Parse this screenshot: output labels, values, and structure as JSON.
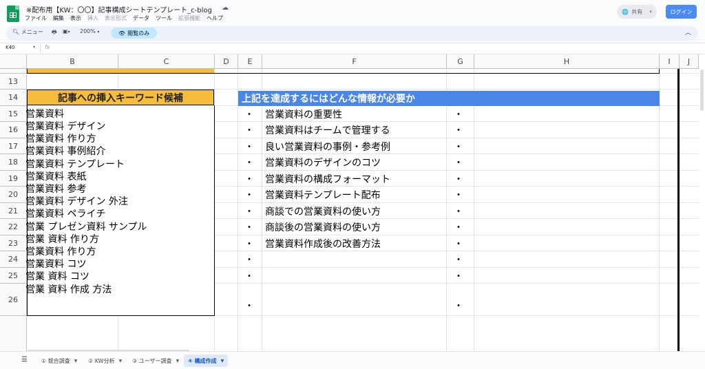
{
  "doc": {
    "title": "※配布用【KW：〇〇】記事構成シートテンプレート_c-blog",
    "menu": [
      "ファイル",
      "編集",
      "表示",
      "挿入",
      "表示形式",
      "データ",
      "ツール",
      "拡張機能",
      "ヘルプ"
    ],
    "share_label": "共有",
    "login_label": "ログイン"
  },
  "toolbar": {
    "menu_search": "メニュー",
    "zoom": "200%",
    "view_only": "閲覧のみ"
  },
  "formula_bar": {
    "cell_ref": "K40",
    "fx": "fx",
    "value": ""
  },
  "columns": [
    "B",
    "C",
    "D",
    "E",
    "F",
    "G",
    "H",
    "I",
    "J"
  ],
  "rows": [
    "13",
    "14",
    "15",
    "16",
    "17",
    "18",
    "19",
    "20",
    "21",
    "22",
    "23",
    "24",
    "25",
    "26"
  ],
  "keyword_section": {
    "header": "記事への挿入キーワード候補",
    "items": [
      "営業資料",
      "営業資料 デザイン",
      "営業資料 作り方",
      "営業資料 事例紹介",
      "営業資料 テンプレート",
      "営業資料 表紙",
      "営業資料 参考",
      "営業資料 デザイン 外注",
      "営業資料 ペライチ",
      "営業 プレゼン資料 サンプル",
      "営業 資料 作り方",
      "営業資料 作り方",
      "営業資料 コツ",
      "営業 資料 コツ",
      "営業 資料 作成 方法"
    ]
  },
  "info_section": {
    "header": "上記を達成するにはどんな情報が必要か",
    "bullet": "・",
    "items": [
      "営業資料の重要性",
      "営業資料はチームで管理する",
      "良い営業資料の事例・参考例",
      "営業資料のデザインのコツ",
      "営業資料の構成フォーマット",
      "営業資料テンプレート配布",
      "商談での営業資料の使い方",
      "商談後の営業資料の使い方",
      "営業資料作成後の改善方法"
    ]
  },
  "sheet_tabs": [
    {
      "label": "① 競合調査",
      "active": false
    },
    {
      "label": "② KW分析",
      "active": false
    },
    {
      "label": "③ ユーザー調査",
      "active": false
    },
    {
      "label": "④ 構成作成",
      "active": true
    }
  ],
  "colors": {
    "keyword_header_bg": "#f5bd3b",
    "info_header_bg": "#4a86e8",
    "login_button": "#4b8af0",
    "app_icon": "#0f9d58"
  }
}
